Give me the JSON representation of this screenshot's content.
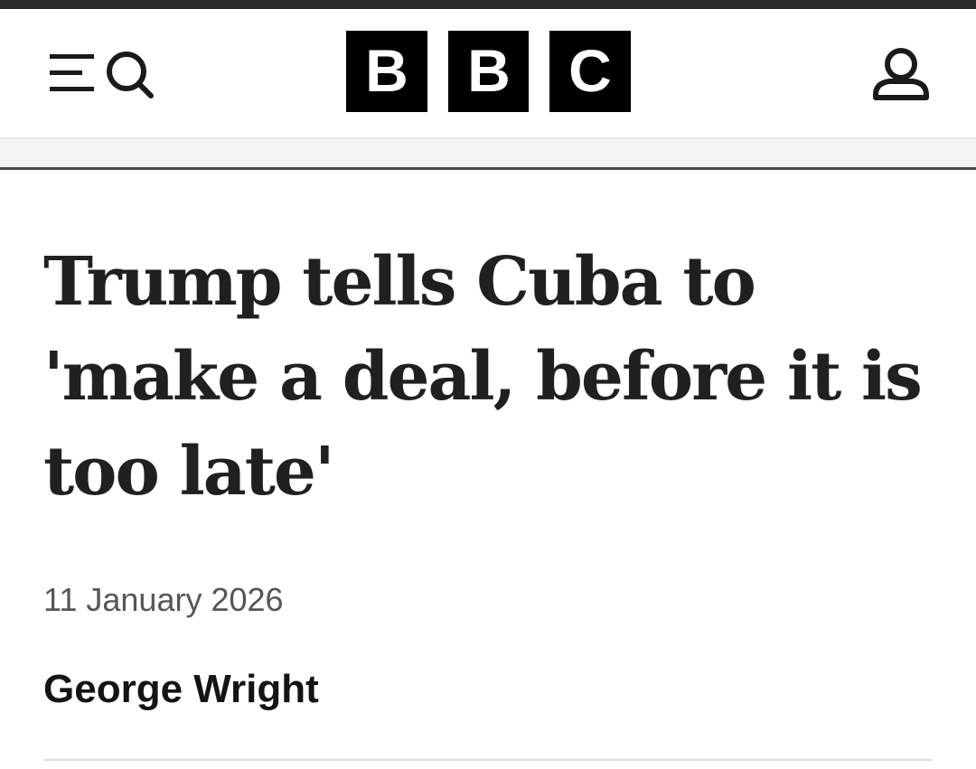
{
  "header": {
    "menu_search_icon": "menu-search-icon",
    "account_icon": "user-icon",
    "logo_letters": [
      "B",
      "B",
      "C"
    ]
  },
  "article": {
    "headline": "Trump tells Cuba to 'make a deal, before it is too late'",
    "date": "11 January 2026",
    "byline": "George Wright"
  },
  "colors": {
    "logo_block": "#000000",
    "headline_text": "#202020",
    "date_text": "#545658",
    "top_strip": "#2a2a2a",
    "nav_band": "#f3f3f3"
  }
}
